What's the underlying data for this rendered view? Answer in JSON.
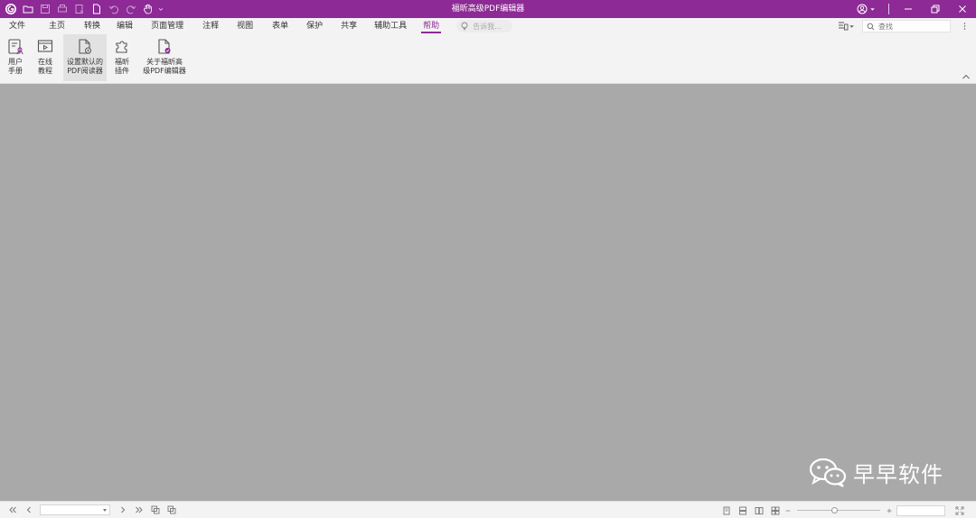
{
  "title": "福昕高级PDF编辑器",
  "menu": {
    "tabs": [
      {
        "label": "文件"
      },
      {
        "label": "主页"
      },
      {
        "label": "转换"
      },
      {
        "label": "编辑"
      },
      {
        "label": "页面管理"
      },
      {
        "label": "注释"
      },
      {
        "label": "视图"
      },
      {
        "label": "表单"
      },
      {
        "label": "保护"
      },
      {
        "label": "共享"
      },
      {
        "label": "辅助工具"
      },
      {
        "label": "帮助",
        "active": true
      }
    ],
    "tell_me_placeholder": "告诉我...",
    "search_placeholder": "查找"
  },
  "ribbon": {
    "buttons": [
      {
        "label": "用户\n手册",
        "icon": "user-manual-icon"
      },
      {
        "label": "在线\n教程",
        "icon": "online-tutorial-icon"
      },
      {
        "label": "设置默认的\nPDF阅读器",
        "icon": "default-reader-icon",
        "selected": true
      },
      {
        "label": "福昕\n插件",
        "icon": "plugin-icon"
      },
      {
        "label": "关于福昕高\n级PDF编辑器",
        "icon": "about-icon"
      }
    ]
  },
  "watermark": {
    "text": "早早软件"
  },
  "status": {
    "page_value": "",
    "zoom_value": "",
    "zoom_level": 0.45
  },
  "colors": {
    "brand": "#8d2a96",
    "workspace": "#a9a9a9",
    "chrome": "#f3f3f3"
  }
}
